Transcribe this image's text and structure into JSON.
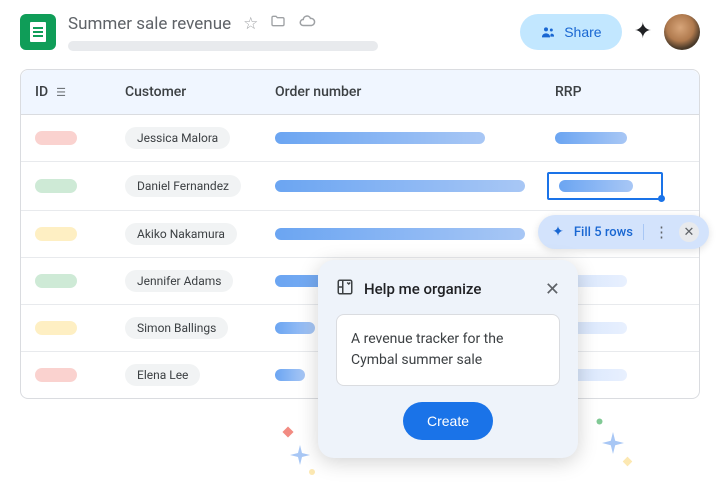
{
  "header": {
    "doc_title": "Summer sale revenue",
    "share_label": "Share"
  },
  "table": {
    "columns": {
      "id": "ID",
      "customer": "Customer",
      "order": "Order number",
      "rrp": "RRP"
    },
    "rows": [
      {
        "id_color": "id-red",
        "customer": "Jessica Malora",
        "order_w": 210,
        "rrp_w": 72,
        "rrp_faded": false,
        "selected": false
      },
      {
        "id_color": "id-green",
        "customer": "Daniel Fernandez",
        "order_w": 250,
        "rrp_w": 74,
        "rrp_faded": false,
        "selected": true
      },
      {
        "id_color": "id-yellow",
        "customer": "Akiko Nakamura",
        "order_w": 250,
        "rrp_w": 72,
        "rrp_faded": true,
        "selected": false
      },
      {
        "id_color": "id-green",
        "customer": "Jennifer Adams",
        "order_w": 250,
        "rrp_w": 72,
        "rrp_faded": true,
        "selected": false
      },
      {
        "id_color": "id-yellow",
        "customer": "Simon Ballings",
        "order_w": 40,
        "rrp_w": 72,
        "rrp_faded": true,
        "selected": false
      },
      {
        "id_color": "id-red",
        "customer": "Elena Lee",
        "order_w": 30,
        "rrp_w": 72,
        "rrp_faded": true,
        "selected": false
      }
    ]
  },
  "smart_chip": {
    "label": "Fill 5 rows"
  },
  "dialog": {
    "title": "Help me organize",
    "input_text": "A revenue tracker for the Cymbal summer sale",
    "create_label": "Create"
  }
}
